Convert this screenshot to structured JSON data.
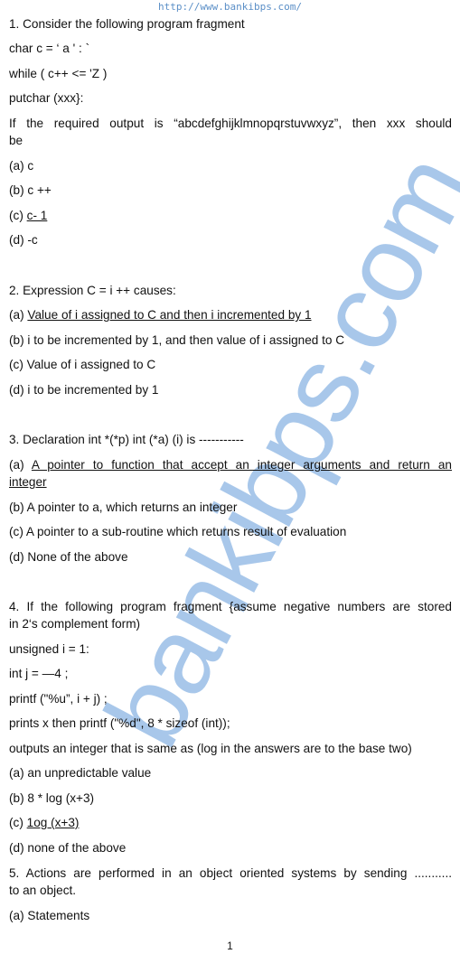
{
  "header": {
    "url": "http://www.bankibps.com/"
  },
  "watermark": "bankibps.com",
  "questions": {
    "q1": {
      "stem": "1. Consider the following program fragment",
      "code": [
        "char c = ‘ a ' : `",
        "while ( c++ <= 'Z )",
        "putchar (xxx}:"
      ],
      "prompt_line1": "If the required output is “abcdefghijklmnopqrstuvwxyz”, then xxx should",
      "prompt_line2": "be",
      "options": [
        {
          "label": "(a)",
          "text": "c"
        },
        {
          "label": "(b)",
          "text": "c ++"
        },
        {
          "label": "(c)",
          "text": "c- 1"
        },
        {
          "label": "(d)",
          "text": "-c"
        }
      ]
    },
    "q2": {
      "stem": "2. Expression C = i ++ causes:",
      "options": [
        {
          "label": "(a)",
          "text": "Value of i assigned to C and then i incremented by 1"
        },
        {
          "label": "(b)",
          "text": "i to be incremented by 1, and then value of i assigned to C"
        },
        {
          "label": "(c)",
          "text": "Value of i assigned to C"
        },
        {
          "label": "(d)",
          "text": "i to be incremented by 1"
        }
      ]
    },
    "q3": {
      "stem": "3. Declaration int *(*p) int (*a) (i) is -----------",
      "options": [
        {
          "label": "(a)",
          "text_line1": "A pointer to function that accept an integer arguments and return an",
          "text_line2": "integer"
        },
        {
          "label": "(b)",
          "text": " A pointer to a, which returns an integer"
        },
        {
          "label": "(c)",
          "text": "A pointer to a sub-routine which returns result of evaluation"
        },
        {
          "label": "(d)",
          "text": "None of  the above"
        }
      ]
    },
    "q4": {
      "stem_line1": "4. If the following program fragment {assume negative numbers are stored",
      "stem_line2": "in 2‘s complement form)",
      "code": [
        "unsigned i = 1:",
        "int  j = —4 ;",
        "printf (\"%u”, i + j) ;",
        "prints x then printf (\"%d\", 8 * sizeof (int));"
      ],
      "prompt": "outputs an integer that is same as (log in the answers are to the base two)",
      "options": [
        {
          "label": "(a)",
          "text": "an unpredictable value"
        },
        {
          "label": "(b)",
          "text": "8 * log (x+3)"
        },
        {
          "label": "(c)",
          "text": "1og (x+3)"
        },
        {
          "label": "(d)",
          "text": "none of the above"
        }
      ]
    },
    "q5": {
      "stem_line1": "5. Actions are performed in an object oriented systems by sending ...........",
      "stem_line2": "to an object.",
      "options": [
        {
          "label": "(a)",
          "text": "Statements"
        }
      ]
    }
  },
  "footer": {
    "page_number": "1"
  }
}
